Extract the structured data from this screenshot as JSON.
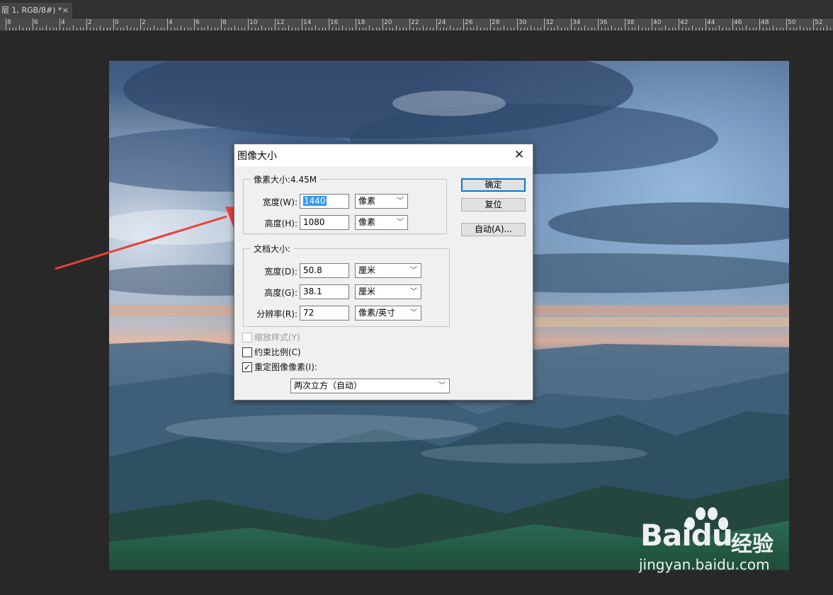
{
  "tab": {
    "label": "层 1, RGB/8#) *",
    "close": "×"
  },
  "ruler": {
    "labels": [
      "8",
      "6",
      "4",
      "2",
      "0",
      "2",
      "4",
      "6",
      "8",
      "10",
      "12",
      "14",
      "16",
      "18",
      "20",
      "22",
      "24",
      "26",
      "28",
      "30",
      "32",
      "34",
      "36",
      "38",
      "40",
      "42",
      "44",
      "46",
      "48",
      "50",
      "52"
    ]
  },
  "dialog": {
    "title": "图像大小",
    "close": "✕",
    "pixel_dimensions": {
      "title": "像素大小:4.45M",
      "width_label": "宽度(W):",
      "width_value": "1440",
      "width_unit": "像素",
      "height_label": "高度(H):",
      "height_value": "1080",
      "height_unit": "像素"
    },
    "document_size": {
      "title": "文档大小:",
      "width_label": "宽度(D):",
      "width_value": "50.8",
      "width_unit": "厘米",
      "height_label": "高度(G):",
      "height_value": "38.1",
      "height_unit": "厘米",
      "resolution_label": "分辨率(R):",
      "resolution_value": "72",
      "resolution_unit": "像素/英寸"
    },
    "buttons": {
      "ok": "确定",
      "reset": "复位",
      "auto": "自动(A)..."
    },
    "options": {
      "scale_styles": "缩放样式(Y)",
      "constrain": "约束比例(C)",
      "resample": "重定图像像素(I):",
      "resample_method": "两次立方（自动）",
      "check_mark": "✓"
    }
  },
  "watermark": {
    "logo_a": "Bai",
    "logo_b": "du",
    "logo_cn": "经验",
    "url": "jingyan.baidu.com"
  },
  "colors": {
    "app_bg": "#282828",
    "arrow": "#e8413a",
    "selection": "#3399ff"
  }
}
